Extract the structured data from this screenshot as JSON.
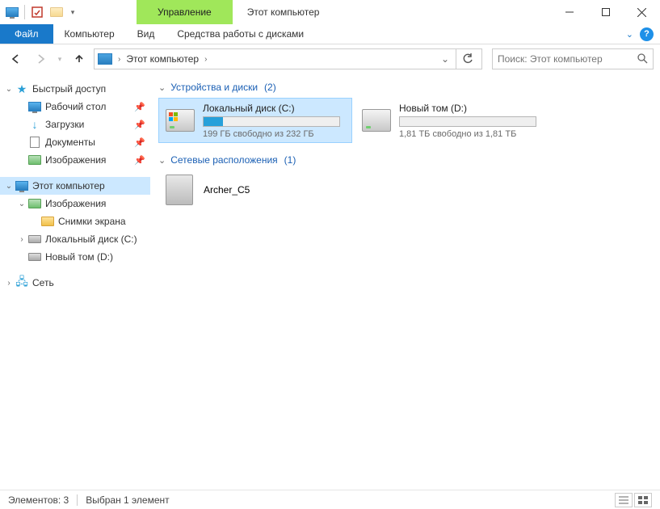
{
  "title": "Этот компьютер",
  "context_tab": "Управление",
  "ribbon": {
    "file": "Файл",
    "computer": "Компьютер",
    "view": "Вид",
    "tools": "Средства работы с дисками"
  },
  "breadcrumb": {
    "item": "Этот компьютер"
  },
  "search": {
    "placeholder": "Поиск: Этот компьютер"
  },
  "tree": {
    "quick_access": "Быстрый доступ",
    "desktop": "Рабочий стол",
    "downloads": "Загрузки",
    "documents": "Документы",
    "pictures": "Изображения",
    "this_pc": "Этот компьютер",
    "pictures2": "Изображения",
    "screenshots": "Снимки экрана",
    "local_disk": "Локальный диск (C:)",
    "new_volume": "Новый том (D:)",
    "network": "Сеть"
  },
  "groups": {
    "devices": {
      "title": "Устройства и диски",
      "count": "(2)"
    },
    "network": {
      "title": "Сетевые расположения",
      "count": "(1)"
    }
  },
  "drives": {
    "c": {
      "name": "Локальный диск (C:)",
      "sub": "199 ГБ свободно из 232 ГБ",
      "fill_pct": 14
    },
    "d": {
      "name": "Новый том (D:)",
      "sub": "1,81 ТБ свободно из 1,81 ТБ",
      "fill_pct": 0
    }
  },
  "netlocs": {
    "archer": "Archer_C5"
  },
  "status": {
    "elements": "Элементов: 3",
    "selected": "Выбран 1 элемент"
  }
}
